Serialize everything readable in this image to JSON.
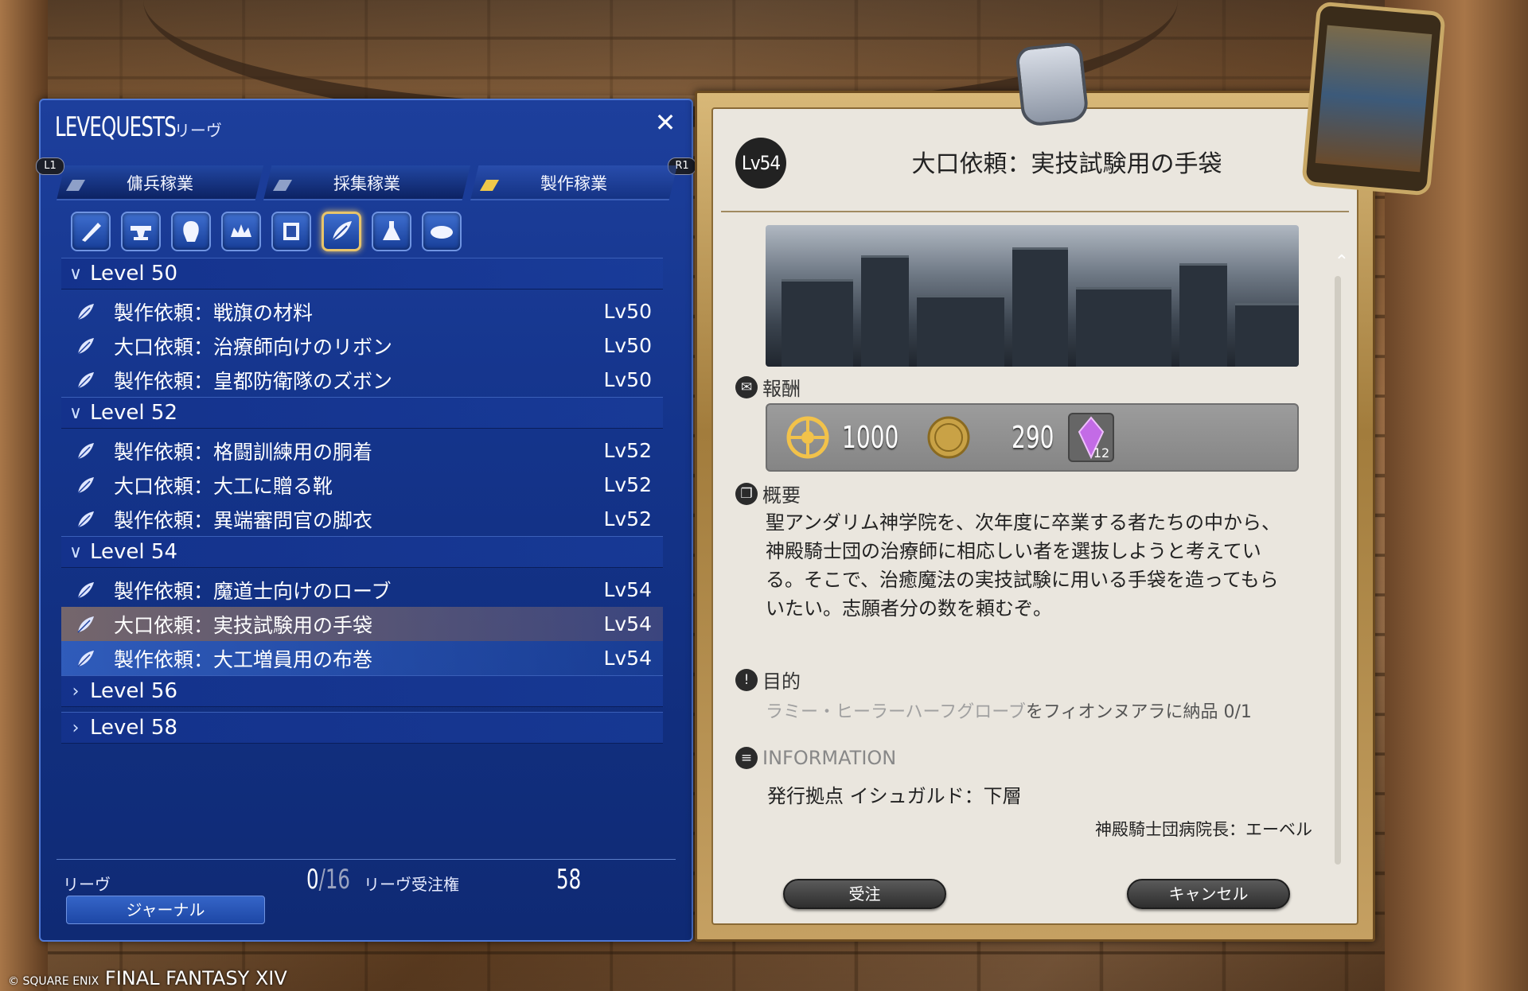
{
  "window": {
    "title": "LEVEQUESTS",
    "subtitle": "リーヴ",
    "close_glyph": "✕"
  },
  "buttons": {
    "l1": "L1",
    "r1": "R1"
  },
  "tabs": [
    {
      "label": "傭兵稼業"
    },
    {
      "label": "採集稼業"
    },
    {
      "label": "製作稼業",
      "active": true
    }
  ],
  "crafts": [
    {
      "icon": "carpenter-icon"
    },
    {
      "icon": "blacksmith-icon"
    },
    {
      "icon": "armorer-icon"
    },
    {
      "icon": "goldsmith-icon"
    },
    {
      "icon": "leatherworker-icon"
    },
    {
      "icon": "weaver-icon",
      "selected": true
    },
    {
      "icon": "alchemist-icon"
    },
    {
      "icon": "culinarian-icon"
    }
  ],
  "levels": [
    {
      "label": "Level 50",
      "expanded": true,
      "quests": [
        {
          "name": "製作依頼：戦旗の材料",
          "lv": "Lv50"
        },
        {
          "name": "大口依頼：治療師向けのリボン",
          "lv": "Lv50"
        },
        {
          "name": "製作依頼：皇都防衛隊のズボン",
          "lv": "Lv50"
        }
      ]
    },
    {
      "label": "Level 52",
      "expanded": true,
      "quests": [
        {
          "name": "製作依頼：格闘訓練用の胴着",
          "lv": "Lv52"
        },
        {
          "name": "大口依頼：大工に贈る靴",
          "lv": "Lv52"
        },
        {
          "name": "製作依頼：異端審問官の脚衣",
          "lv": "Lv52"
        }
      ]
    },
    {
      "label": "Level 54",
      "expanded": true,
      "quests": [
        {
          "name": "製作依頼：魔道士向けのローブ",
          "lv": "Lv54"
        },
        {
          "name": "大口依頼：実技試験用の手袋",
          "lv": "Lv54",
          "selected": true
        },
        {
          "name": "製作依頼：大工増員用の布巻",
          "lv": "Lv54",
          "hover": true
        }
      ]
    },
    {
      "label": "Level 56",
      "expanded": false,
      "quests": []
    },
    {
      "label": "Level 58",
      "expanded": false,
      "quests": []
    }
  ],
  "footer": {
    "leve_label": "リーヴ",
    "leve_count": "0",
    "leve_max": "16",
    "allow_label": "リーヴ受注権",
    "allow_value": "58",
    "journal": "ジャーナル"
  },
  "detail": {
    "level": "Lv54",
    "title": "大口依頼：実技試験用の手袋",
    "reward_label": "報酬",
    "rewards": {
      "exp": "1000",
      "gil": "290",
      "crystal_count": "12"
    },
    "summary_label": "概要",
    "summary": "聖アンダリム神学院を、次年度に卒業する者たちの中から、神殿騎士団の治療師に相応しい者を選抜しようと考えている。そこで、治癒魔法の実技試験に用いる手袋を造ってもらいたい。志願者分の数を頼むぞ。",
    "objective_label": "目的",
    "objective_item": "ラミー・ヒーラーハーフグローブ",
    "objective_rest": "をフィオンヌアラに納品 0/1",
    "info_label": "INFORMATION",
    "info_location": "発行拠点 イシュガルド：下層",
    "info_client": "神殿騎士団病院長：エーベル",
    "accept": "受注",
    "cancel": "キャンセル"
  },
  "brand": {
    "copyright": "© SQUARE ENIX",
    "game": "FINAL FANTASY XIV"
  }
}
